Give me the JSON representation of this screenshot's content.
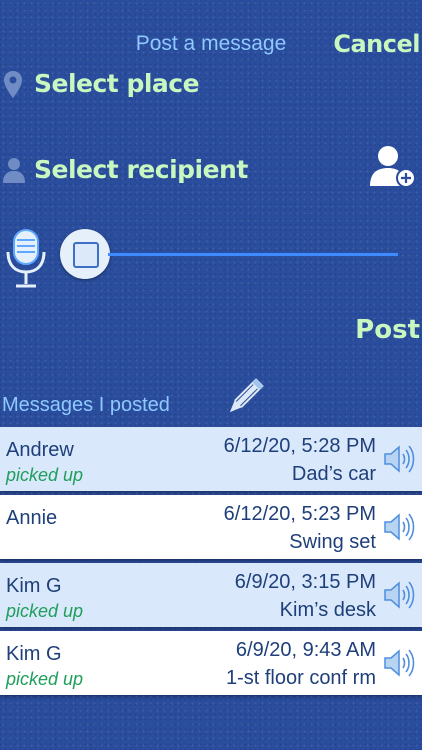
{
  "header": {
    "title": "Post a message",
    "cancel_label": "Cancel"
  },
  "form": {
    "place_label": "Select place",
    "recipient_label": "Select recipient",
    "post_label": "Post"
  },
  "messages": {
    "title": "Messages I posted",
    "items": [
      {
        "name": "Andrew",
        "status": "picked up",
        "date": "6/12/20, 5:28 PM",
        "place": "Dad’s car"
      },
      {
        "name": "Annie",
        "status": "",
        "date": "6/12/20, 5:23 PM",
        "place": "Swing set"
      },
      {
        "name": "Kim G",
        "status": "picked up",
        "date": "6/9/20, 3:15 PM",
        "place": "Kim’s desk"
      },
      {
        "name": "Kim G",
        "status": "picked up",
        "date": "6/9/20, 9:43 AM",
        "place": "1-st floor conf rm"
      }
    ]
  },
  "colors": {
    "background": "#2a4d9e",
    "title_blue": "#8ec9ff",
    "action_green": "#c8f7c0",
    "status_green": "#1f9e5c"
  },
  "icons": [
    "map-pin-icon",
    "person-icon",
    "add-person-icon",
    "microphone-icon",
    "stop-icon",
    "pencil-icon",
    "speaker-icon"
  ]
}
